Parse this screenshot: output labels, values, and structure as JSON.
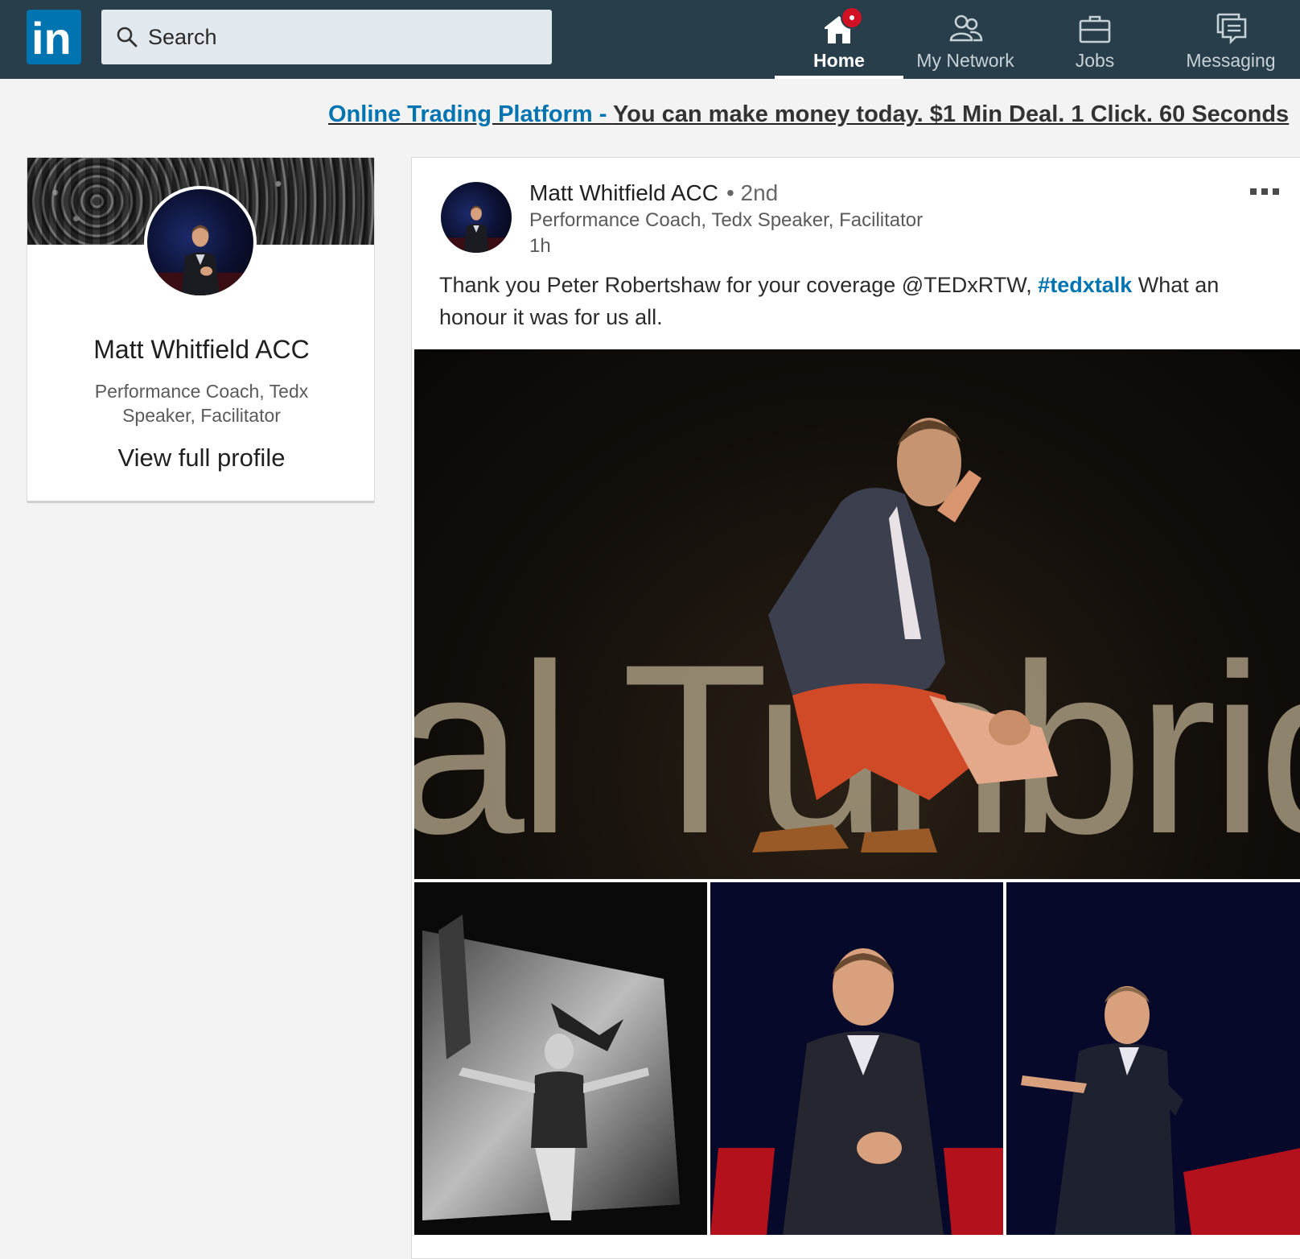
{
  "nav": {
    "logo_text": "in",
    "search_placeholder": "Search",
    "items": [
      {
        "label": "Home",
        "icon": "home-icon",
        "active": true,
        "has_notification": true
      },
      {
        "label": "My Network",
        "icon": "my-network-icon",
        "active": false
      },
      {
        "label": "Jobs",
        "icon": "jobs-icon",
        "active": false
      },
      {
        "label": "Messaging",
        "icon": "messaging-icon",
        "active": false
      }
    ]
  },
  "ad": {
    "link_text": "Online Trading Platform - ",
    "text": "You can make money today. $1 Min Deal. 1 Click. 60 Seconds"
  },
  "profile_card": {
    "name": "Matt Whitfield ACC",
    "headline": "Performance Coach, Tedx Speaker, Facilitator",
    "view_profile": "View full profile"
  },
  "post": {
    "author": "Matt Whitfield ACC",
    "degree": "• 2nd",
    "headline": "Performance Coach, Tedx Speaker, Facilitator",
    "time": "1h",
    "text_before": "Thank you Peter Robertshaw for your coverage @TEDxRTW, ",
    "hashtag": "#tedxtalk",
    "text_after": " What an honour it was for us all.",
    "main_photo_stage_text": "al Tunbridge"
  },
  "colors": {
    "nav_bg": "#283e4a",
    "brand_blue": "#0073b1",
    "notification_red": "#d11124",
    "page_bg": "#f3f3f3"
  }
}
